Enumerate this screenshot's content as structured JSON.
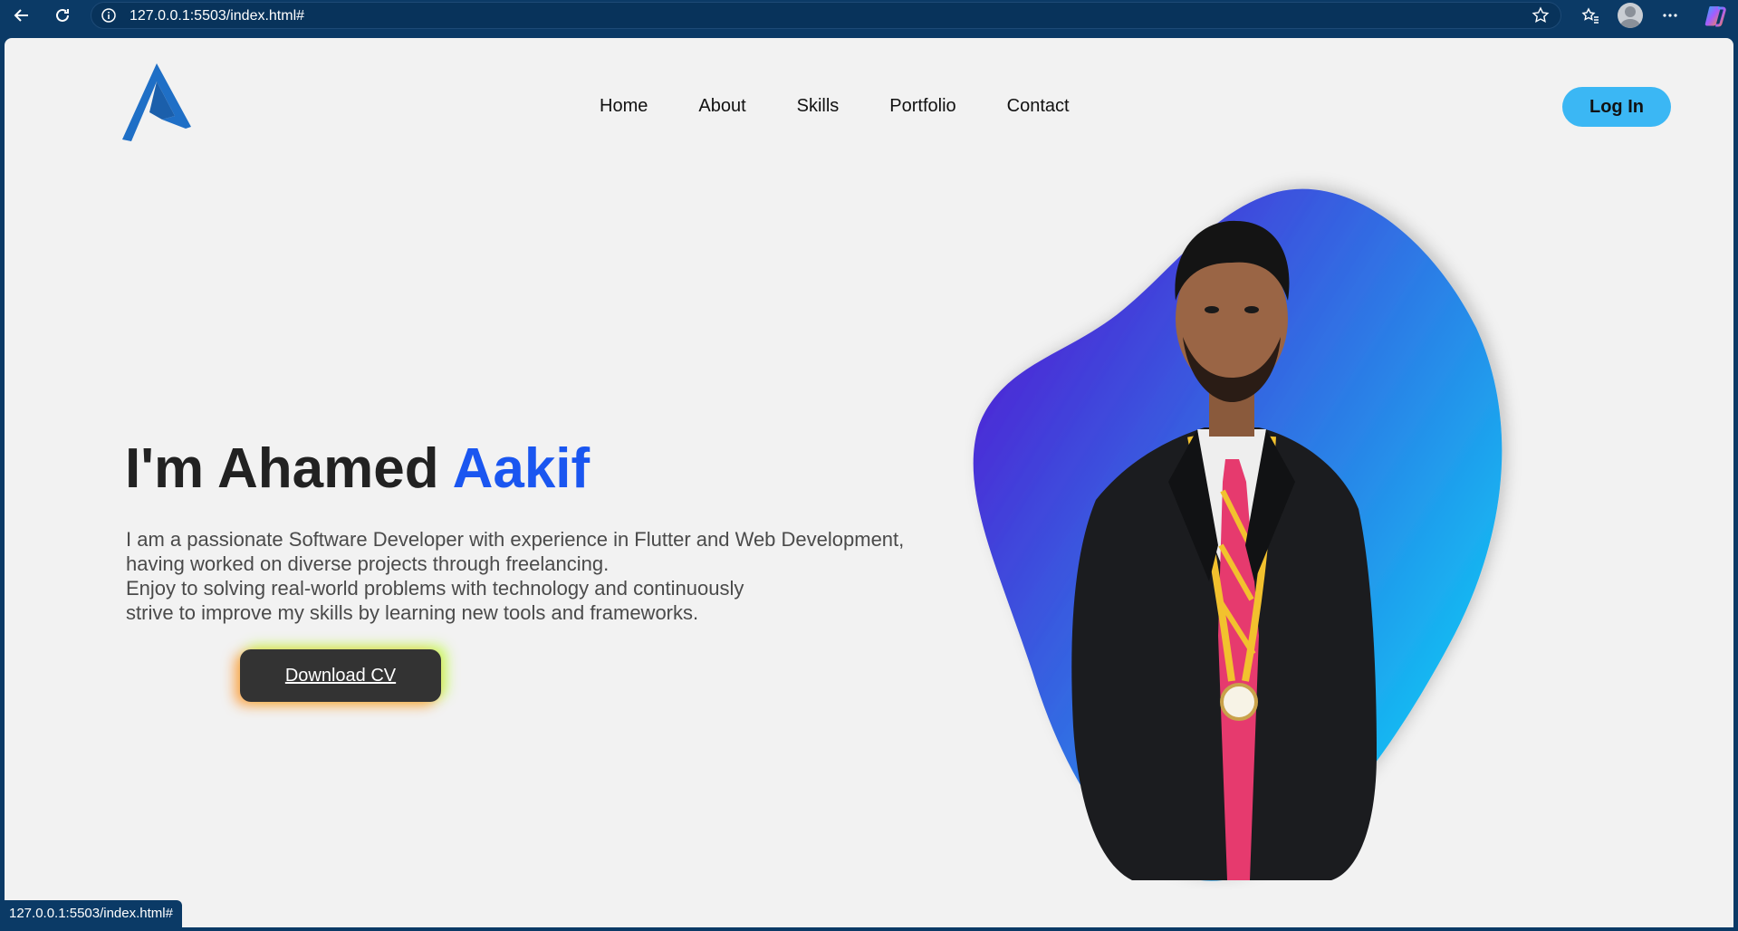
{
  "browser": {
    "url": "127.0.0.1:5503/index.html#",
    "status_url": "127.0.0.1:5503/index.html#"
  },
  "header": {
    "nav": [
      "Home",
      "About",
      "Skills",
      "Portfolio",
      "Contact"
    ],
    "login_label": "Log In"
  },
  "hero": {
    "title_prefix": "I'm Ahamed ",
    "title_accent": "Aakif",
    "description_lines": [
      "I am a passionate Software Developer with experience in Flutter and Web Development,",
      "having worked on diverse projects through freelancing.",
      "Enjoy to solving real-world problems with technology and continuously",
      "strive to improve my skills by learning new tools and frameworks."
    ],
    "cv_label": "Download CV"
  },
  "colors": {
    "accent": "#1a56f0",
    "login_button": "#3bb7f4",
    "cv_button": "#333333",
    "blob_start": "#4a2bd6",
    "blob_end": "#10c8f5"
  }
}
